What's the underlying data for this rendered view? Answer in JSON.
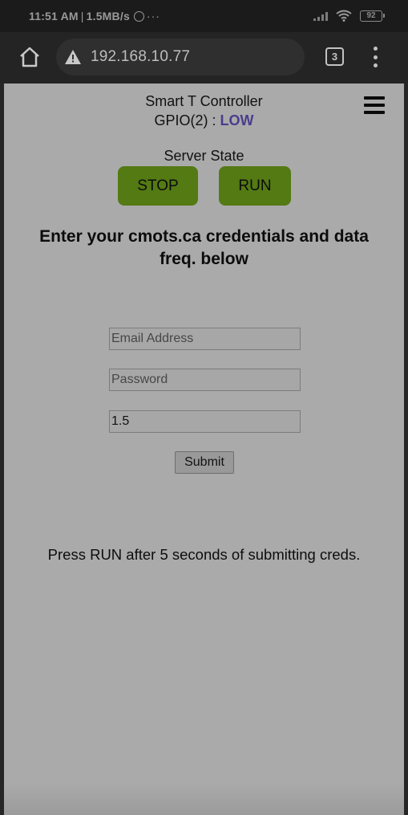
{
  "status_bar": {
    "time": "11:51 AM",
    "separator": "|",
    "speed": "1.5MB/s",
    "dots": "···",
    "battery": "92"
  },
  "browser": {
    "url": "192.168.10.77",
    "tab_count": "3"
  },
  "page": {
    "title": "Smart T Controller",
    "gpio_label": "GPIO(2) : ",
    "gpio_value": "LOW",
    "server_state_label": "Server State",
    "stop_label": "STOP",
    "run_label": "RUN",
    "heading": "Enter your cmots.ca credentials and data freq. below",
    "email_placeholder": "Email Address",
    "password_placeholder": "Password",
    "freq_value": "1.5",
    "submit_label": "Submit",
    "note": "Press RUN after 5 seconds of submitting creds."
  },
  "colors": {
    "run_stop_button": "#537a13",
    "gpio_value": "#4a3d8e",
    "page_background": "#aaaaaa"
  },
  "icons": [
    "home-icon",
    "warning-icon",
    "tabs-icon",
    "more-vert-icon",
    "hamburger-menu-icon",
    "whatsapp-icon",
    "signal-icon",
    "wifi-icon",
    "battery-icon"
  ]
}
